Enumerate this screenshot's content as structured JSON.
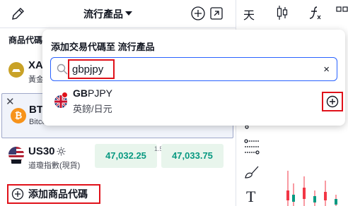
{
  "header": {
    "list_title": "流行產品"
  },
  "watchlist": {
    "column_header": "商品代碼",
    "rows": [
      {
        "symbol": "XA",
        "description": "黃金"
      },
      {
        "symbol": "BTC",
        "description": "Bitco"
      },
      {
        "symbol": "US30",
        "description": "道瓊指數(現貨)",
        "bid": "47,032.25",
        "spread": "1.5",
        "ask": "47,033.75"
      }
    ],
    "add_symbol_label": "添加商品代碼"
  },
  "popup": {
    "title": "添加交易代碼至 流行產品",
    "search_value": "gbpjpy",
    "clear_glyph": "×",
    "result": {
      "symbol_match": "GB",
      "symbol_rest": "PJPY",
      "description": "英鎊/日元"
    }
  },
  "toolbar": {
    "tian_label": "天",
    "text_tool_label": "T"
  },
  "colors": {
    "accent_red": "#e0111a",
    "price_green": "#089981",
    "focus_blue": "#2962ff"
  }
}
